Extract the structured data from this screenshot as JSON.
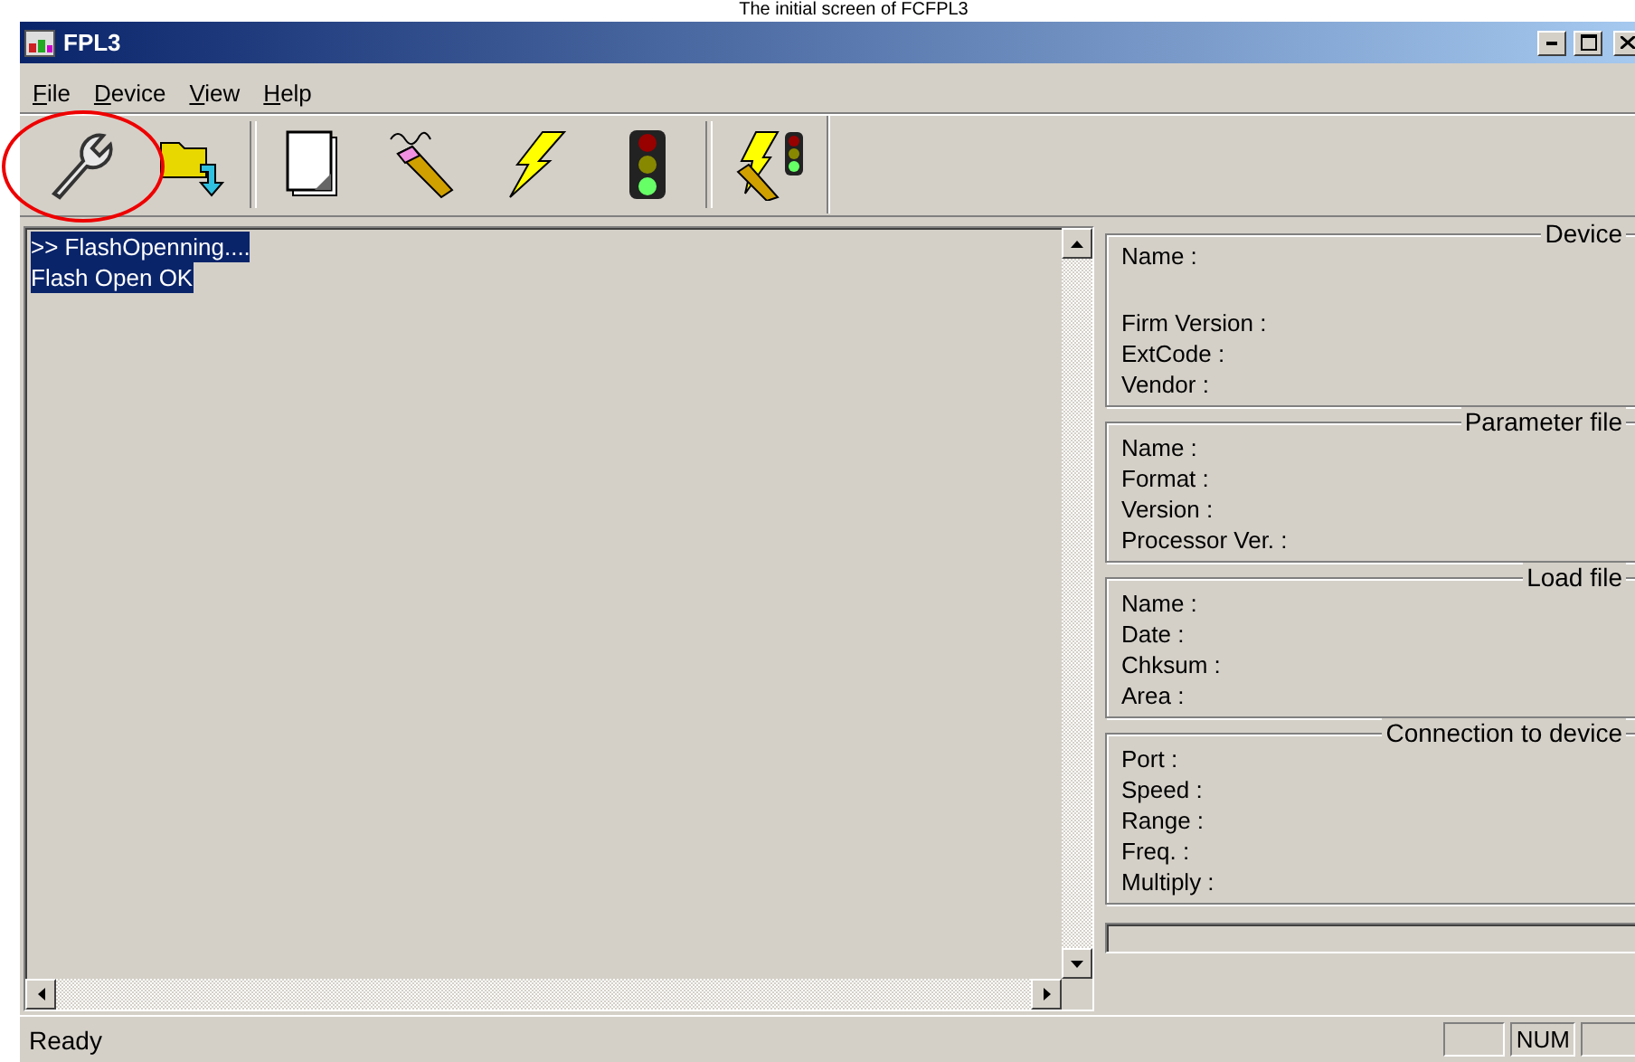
{
  "caption": "The initial screen of FCFPL3",
  "window": {
    "title": "FPL3"
  },
  "menu": [
    {
      "label": "File"
    },
    {
      "label": "Device"
    },
    {
      "label": "View"
    },
    {
      "label": "Help"
    }
  ],
  "toolbar": [
    {
      "kind": "wrench"
    },
    {
      "kind": "open"
    },
    {
      "kind": "separator"
    },
    {
      "kind": "page"
    },
    {
      "kind": "erase"
    },
    {
      "kind": "flash"
    },
    {
      "kind": "signal"
    },
    {
      "kind": "separator"
    },
    {
      "kind": "auto"
    }
  ],
  "log": [
    {
      "text": ">> FlashOpenning....",
      "selected": true
    },
    {
      "text": "Flash Open OK",
      "selected": true
    }
  ],
  "groups": [
    {
      "title": "Device",
      "fields": [
        "Name :",
        "Firm Version :",
        "ExtCode :",
        "Vendor :"
      ]
    },
    {
      "title": "Parameter file",
      "fields": [
        "Name :",
        "Format :",
        "Version :",
        "Processor Ver. :"
      ]
    },
    {
      "title": "Load file",
      "fields": [
        "Name :",
        "Date :",
        "Chksum :",
        "Area :"
      ]
    },
    {
      "title": "Connection to device",
      "fields": [
        "Port :",
        "Speed :",
        "Range :",
        "Freq. :",
        "Multiply :"
      ]
    }
  ],
  "progress": {
    "level": 0
  },
  "status": {
    "text": "Ready",
    "panes": [
      {
        "kind": "empty"
      },
      {
        "kind": "text",
        "label": "NUM"
      },
      {
        "kind": "empty"
      }
    ]
  }
}
